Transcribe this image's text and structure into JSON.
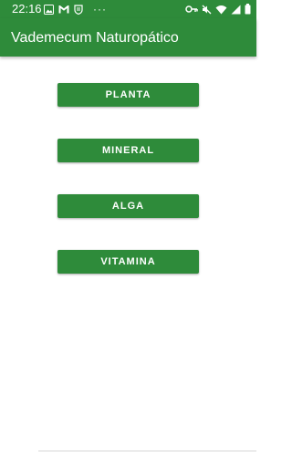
{
  "status_bar": {
    "time": "22:16",
    "overflow": "···",
    "left_icons": [
      "image-icon",
      "gmail-icon",
      "shield-icon"
    ],
    "right_icons": [
      "key-icon",
      "mute-icon",
      "wifi-icon",
      "signal-icon",
      "battery-icon"
    ]
  },
  "app_bar": {
    "title": "Vademecum Naturopático"
  },
  "main": {
    "buttons": [
      {
        "label": "PLANTA"
      },
      {
        "label": "MINERAL"
      },
      {
        "label": "ALGA"
      },
      {
        "label": "VITAMINA"
      }
    ]
  },
  "colors": {
    "primary": "#2e8b3a",
    "on_primary": "#ffffff",
    "background": "#ffffff"
  }
}
